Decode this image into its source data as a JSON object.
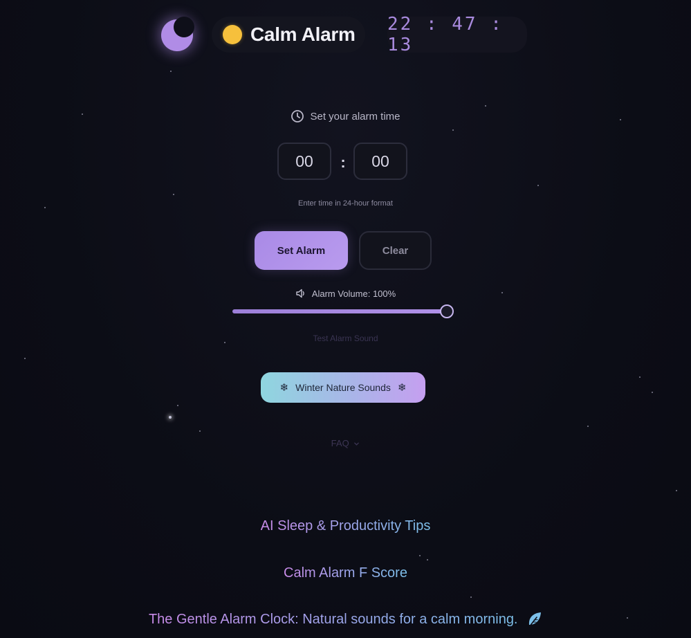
{
  "header": {
    "theme_toggle_icon": "moon-icon",
    "brand_icon": "sun-icon",
    "brand_title": "Calm Alarm",
    "current_time": "22:47:13"
  },
  "alarm": {
    "set_label": "Set your alarm time",
    "set_label_icon": "clock-icon",
    "hours": "00",
    "minutes": "00",
    "separator": ":",
    "hint": "Enter time in 24-hour format",
    "set_button": "Set Alarm",
    "clear_button": "Clear"
  },
  "volume": {
    "icon": "speaker-icon",
    "label": "Alarm Volume: 100%",
    "value_percent": 100,
    "test_sound": "Test Alarm Sound"
  },
  "nature": {
    "label": "Winter Nature Sounds",
    "icon": "snowflake-icon",
    "glyph": "❄"
  },
  "faq": {
    "label": "FAQ",
    "icon": "chevron-down-icon"
  },
  "links": {
    "tips": "AI Sleep & Productivity Tips",
    "score": "Calm Alarm F Score",
    "tagline": "The Gentle Alarm Clock: Natural sounds for a calm morning.",
    "tagline_icon": "leaf-icon"
  },
  "colors": {
    "accent": "#a98ae6",
    "background": "#0c0d16",
    "sun": "#f6c03c"
  }
}
